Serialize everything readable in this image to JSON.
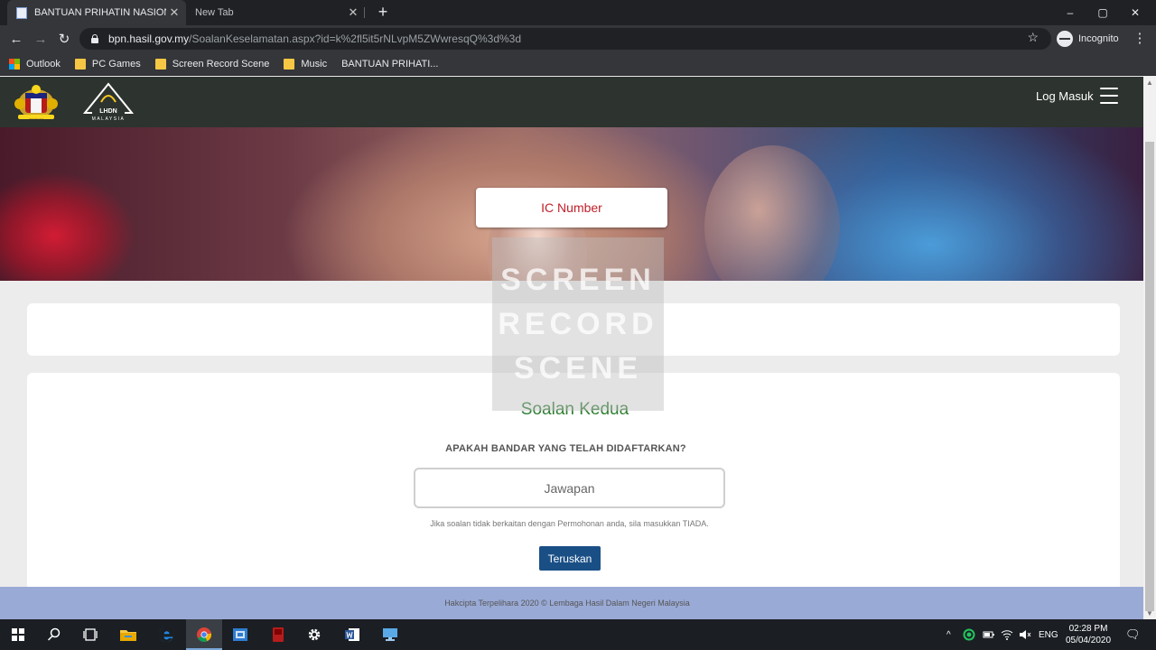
{
  "browser": {
    "tabs": [
      {
        "title": "BANTUAN PRIHATIN NASIONAL",
        "active": true
      },
      {
        "title": "New Tab",
        "active": false
      }
    ],
    "new_tab": "+",
    "window_controls": {
      "minimize": "–",
      "maximize": "▢",
      "close": "✕"
    },
    "nav": {
      "back": "←",
      "forward": "→",
      "reload": "↻"
    },
    "url_host": "bpn.hasil.gov.my",
    "url_path": "/SoalanKeselamatan.aspx?id=k%2fl5it5rNLvpM5ZWwresqQ%3d%3d",
    "bookmark_star": "☆",
    "incognito_label": "Incognito",
    "menu": "⋮",
    "bookmarks": [
      {
        "label": "Outlook",
        "icon": "microsoft-icon"
      },
      {
        "label": "PC Games",
        "icon": "folder-icon"
      },
      {
        "label": "Screen Record Scene",
        "icon": "folder-icon"
      },
      {
        "label": "Music",
        "icon": "folder-icon"
      },
      {
        "label": "BANTUAN PRIHATI...",
        "icon": "page-icon"
      }
    ]
  },
  "site": {
    "login_label": "Log Masuk",
    "crest_label": "Jata Negara",
    "lhdn_label": "LHDN",
    "lhdn_sub": "MALAYSIA",
    "ic_label": "IC Number",
    "watermark": [
      "SCREEN",
      "RECORD",
      "SCENE"
    ],
    "question_title": "Soalan Kedua",
    "question_text": "APAKAH BANDAR YANG TELAH DIDAFTARKAN?",
    "answer_placeholder": "Jawapan",
    "answer_value": "",
    "hint": "Jika soalan tidak berkaitan dengan Permohonan anda, sila masukkan TIADA.",
    "submit_label": "Teruskan",
    "footer": "Hakcipta Terpelihara 2020 © Lembaga Hasil Dalam Negeri Malaysia"
  },
  "taskbar": {
    "apps": [
      "start-icon",
      "search-icon",
      "task-view-icon",
      "file-explorer-icon",
      "edge-icon",
      "chrome-icon",
      "outlook-app-icon",
      "red-app-icon",
      "settings-icon",
      "word-icon",
      "remote-desktop-icon"
    ],
    "tray": {
      "caret": "^",
      "language": "ENG"
    },
    "time": "02:28 PM",
    "date": "05/04/2020",
    "notifications": "🗨"
  },
  "colors": {
    "accent": "#1a4f86",
    "question_green": "#2e7d32",
    "ic_red": "#c0202a",
    "nav_bg": "#2d332f",
    "footer_bg": "#9aaad6"
  }
}
